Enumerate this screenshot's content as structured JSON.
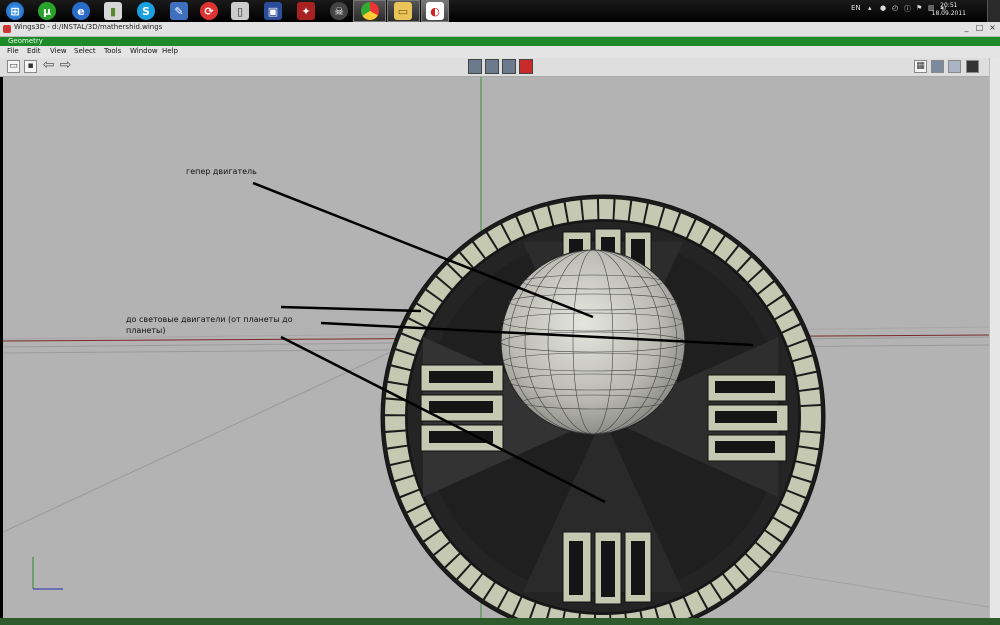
{
  "taskbar": {
    "icons": [
      "start-orb",
      "utorrent",
      "ie",
      "phone",
      "skype",
      "edit",
      "sound",
      "save",
      "game",
      "chrome",
      "folder",
      "wings3d"
    ],
    "tray_lang": "EN",
    "clock_time": "20:51",
    "clock_date": "18.09.2011"
  },
  "window": {
    "title": "Wings3D - d:/INSTAL/3D/mathershid.wings",
    "geometry_title": "Geometry",
    "minimize": "_",
    "maximize": "□",
    "close": "×"
  },
  "menus": [
    "File",
    "Edit",
    "View",
    "Select",
    "Tools",
    "Window",
    "Help"
  ],
  "annotations": {
    "hyper": "гепер двигатель",
    "sublight_line1": "до световые двигатели (от планеты до",
    "sublight_line2": "планеты)"
  },
  "colors": {
    "viewport_bg": "#b3b3b3",
    "model_dark": "#1b1b1b",
    "model_light": "#c6c9b1",
    "title_green": "#1f8a2a"
  }
}
